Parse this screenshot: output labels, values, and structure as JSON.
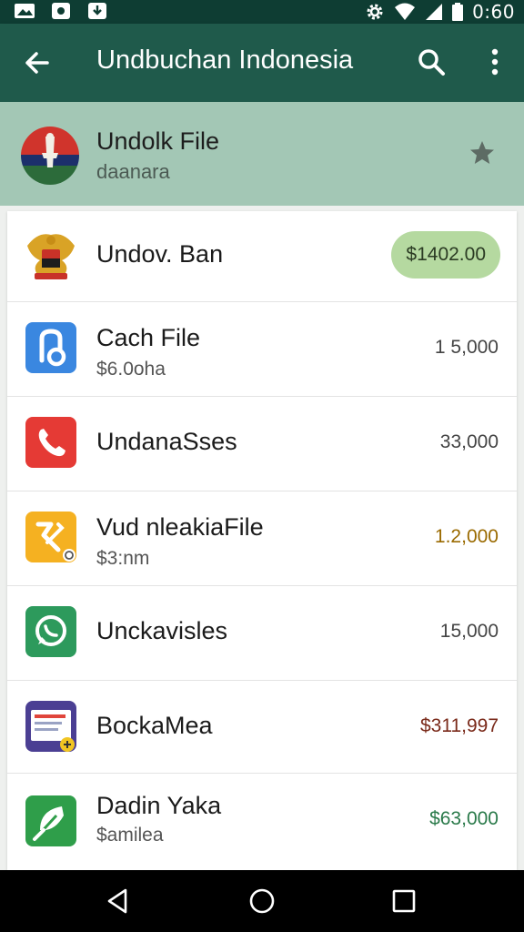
{
  "status_bar": {
    "time": "0:60"
  },
  "app_bar": {
    "title": "Undbuchan Indonesia"
  },
  "featured": {
    "title": "Undolk File",
    "subtitle": "daanara"
  },
  "colors": {
    "status_bar": "#0e3d33",
    "app_bar": "#1f5a4b",
    "featured_bg": "#a3c7b5",
    "price_pill": "#b5d9a0",
    "price_orange": "#9a6a00",
    "price_green": "#2a7a4a"
  },
  "items": [
    {
      "title": "Undov. Ban",
      "subtitle": "",
      "price": "$1402.00",
      "icon": "national-emblem-icon"
    },
    {
      "title": "Cach File",
      "subtitle": "$6.0oha",
      "price": "1 5,000",
      "icon": "file-search-icon"
    },
    {
      "title": "UndanaSses",
      "subtitle": "",
      "price": "33,000",
      "icon": "phone-icon"
    },
    {
      "title": "Vud nleakiaFile",
      "subtitle": "$3:nm",
      "price": "1.2,000",
      "icon": "edit-tool-icon"
    },
    {
      "title": "Unckavisles",
      "subtitle": "",
      "price": "15,000",
      "icon": "chat-bubble-icon"
    },
    {
      "title": "BockaMea",
      "subtitle": "",
      "price": "$311,997",
      "icon": "document-icon"
    },
    {
      "title": "Dadin Yaka",
      "subtitle": "$amilea",
      "price": "$63,000",
      "icon": "leaf-icon"
    }
  ]
}
